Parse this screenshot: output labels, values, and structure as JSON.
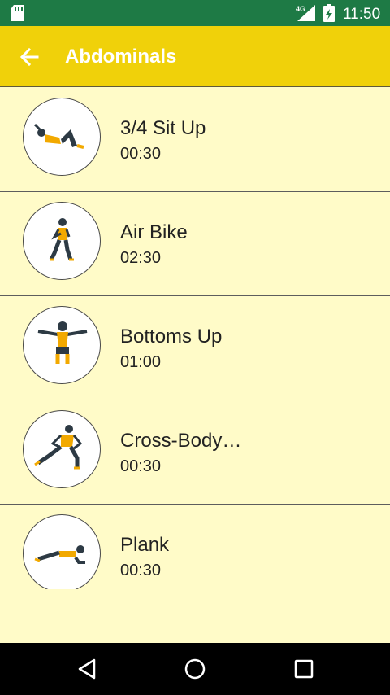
{
  "status_bar": {
    "network": "4G",
    "time": "11:50"
  },
  "app_bar": {
    "title": "Abdominals"
  },
  "exercises": [
    {
      "name": "3/4 Sit Up",
      "duration": "00:30",
      "icon": "sit-up-figure-icon"
    },
    {
      "name": "Air Bike",
      "duration": "02:30",
      "icon": "air-bike-figure-icon"
    },
    {
      "name": "Bottoms Up",
      "duration": "01:00",
      "icon": "bottoms-up-figure-icon"
    },
    {
      "name": "Cross-Body…",
      "duration": "00:30",
      "icon": "cross-body-figure-icon"
    },
    {
      "name": "Plank",
      "duration": "00:30",
      "icon": "plank-figure-icon"
    }
  ],
  "colors": {
    "status_bar": "#1e7a45",
    "app_bar": "#f0d10a",
    "list_background": "#fffbc8",
    "figure_shirt": "#f2a900",
    "figure_body": "#2d3a44"
  }
}
